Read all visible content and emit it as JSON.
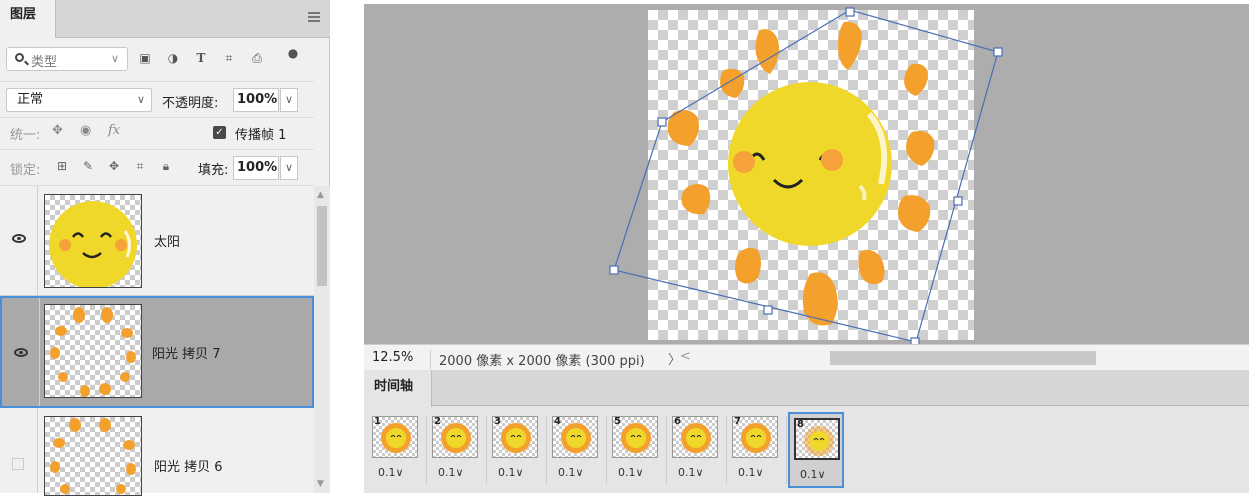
{
  "layers_panel": {
    "tab": "图层",
    "filter": {
      "placeholder": "类型",
      "chevron": "∨"
    },
    "blend": {
      "mode": "正常",
      "chevron": "∨",
      "opacity_label": "不透明度:",
      "opacity_value": "100%"
    },
    "unify": {
      "label": "统一:",
      "propagate_label": "传播帧",
      "propagate_value": "1",
      "propagate_checked": true
    },
    "lock": {
      "label": "锁定:",
      "fill_label": "填充:",
      "fill_value": "100%"
    },
    "layers": [
      {
        "name": "太阳",
        "visible": true,
        "selected": false
      },
      {
        "name": "阳光 拷贝 7",
        "visible": true,
        "selected": true
      },
      {
        "name": "阳光 拷贝 6",
        "visible": false,
        "selected": false
      }
    ],
    "dropdown_glyph": "∨"
  },
  "status_bar": {
    "zoom": "12.5%",
    "doc_info": "2000 像素 x 2000 像素 (300 ppi)",
    "arrow": "〉",
    "scroll_left": "<"
  },
  "timeline": {
    "tab": "时间轴",
    "frames": [
      {
        "num": "1",
        "delay": "0.1∨"
      },
      {
        "num": "2",
        "delay": "0.1∨"
      },
      {
        "num": "3",
        "delay": "0.1∨"
      },
      {
        "num": "4",
        "delay": "0.1∨"
      },
      {
        "num": "5",
        "delay": "0.1∨"
      },
      {
        "num": "6",
        "delay": "0.1∨"
      },
      {
        "num": "7",
        "delay": "0.1∨"
      },
      {
        "num": "8",
        "delay": "0.1∨",
        "selected": true
      }
    ]
  },
  "colors": {
    "sun_yellow": "#f0d82a",
    "ray_orange": "#f3a12c",
    "cheek_orange": "#f6a23a",
    "selection_blue": "#4a90d9",
    "transform_box": "#4a6fb5"
  }
}
